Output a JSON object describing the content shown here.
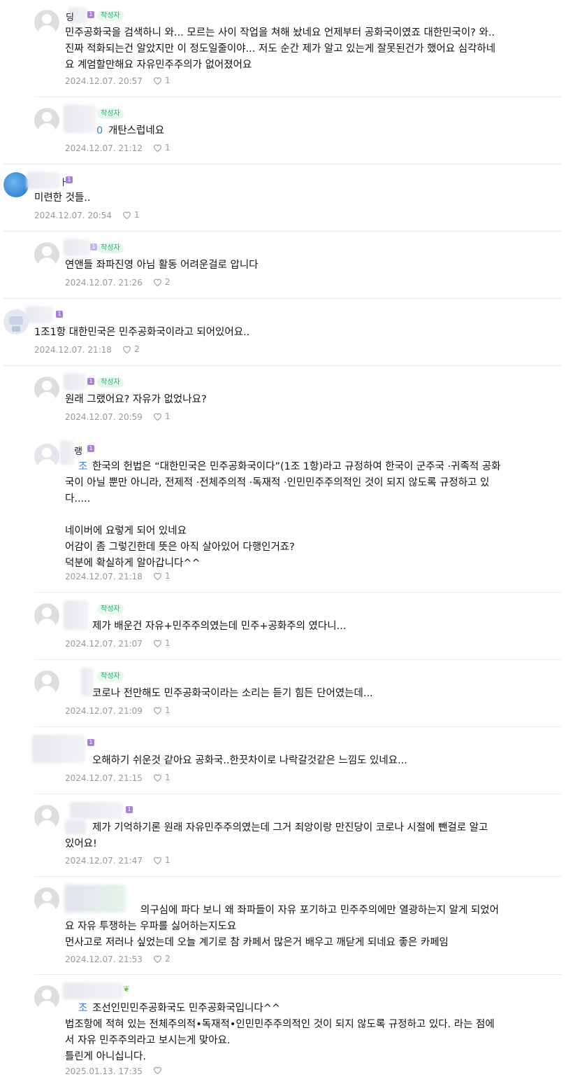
{
  "comments": [
    {
      "nick_visible": "딩",
      "author_badge": "작성자",
      "level": "1",
      "text": "민주공화국을 검색하니 와... 모르는 사이 작업을 쳐해 놨네요 언제부터 공화국이였죠 대한민국이? 와..\n진짜 적화되는건 알았지만 이 정도일줄이야... 저도 순간 제가 알고 있는게 잘못된건가 했어요 심각하네\n요 계엄할만해요 자유민주주의가 없어졌어요",
      "date": "2024.12.07. 20:57",
      "likes": "1"
    },
    {
      "author_badge": "작성자",
      "mention": "0",
      "text": "개탄스럽네요",
      "date": "2024.12.07. 21:12",
      "likes": "1"
    },
    {
      "nick_visible": "ㅏ",
      "level": "1",
      "text": "미련한 것들..",
      "date": "2024.12.07. 20:54",
      "likes": "1"
    },
    {
      "author_badge": "작성자",
      "level": "1",
      "text": "연앤들 좌파진영 아님 활동 어려운걸로 압니다",
      "date": "2024.12.07. 21:26",
      "likes": "2"
    },
    {
      "level": "1",
      "text": "1조1항 대한민국은 민주공화국이라고 되어있어요..",
      "date": "2024.12.07. 21:18",
      "likes": "2"
    },
    {
      "author_badge": "작성자",
      "level": "1",
      "text": "원래 그랬어요? 자유가 없었나요?",
      "date": "2024.12.07. 20:59",
      "likes": "1"
    },
    {
      "nick_visible": "랭",
      "level": "1",
      "mention": "조",
      "text": "한국의 헌법은 “대한민국은 민주공화국이다”(1조 1항)라고 규정하여 한국이 군주국 ·귀족적 공화\n국이 아닐 뿐만 아니라, 전제적 ·전체주의적 ·독재적 ·인민민주주의적인 것이 되지 않도록 규정하고 있\n다.....\n\n네이버에 요렇게 되어 있네요\n어감이 좀 그렇긴한데 뜻은 아직 살아있어 다행인거죠?\n덕분에 확실하게 알아갑니다^^",
      "date": "2024.12.07. 21:18",
      "likes": "1"
    },
    {
      "author_badge": "작성자",
      "text": "제가 배운건 자유+민주주의였는데 민주+공화주의 였다니...",
      "date": "2024.12.07. 21:07",
      "likes": "1"
    },
    {
      "author_badge": "작성자",
      "text": "코로나 전만해도 민주공화국이라는 소리는 듣기 힘든 단어였는데...",
      "date": "2024.12.07. 21:09",
      "likes": "1"
    },
    {
      "level": "1",
      "text": "오해하기 쉬운것 같아요 공화국..한끗차이로 나락갈것같은 느낌도 있네요...",
      "date": "2024.12.07. 21:15",
      "likes": "1"
    },
    {
      "level": "1",
      "text": "제가 기억하기론 원래 자유민주주의였는데 그거 죄앙이랑 만진당이 코로나 시절에 뺀걸로 알고\n있어요!",
      "date": "2024.12.07. 21:47",
      "likes": "1"
    },
    {
      "text": "의구심에 파다 보니 왜 좌파들이 자유 포기하고 민주주의에만 열광하는지 알게 되었어\n요 자유 투쟁하는 우파를 싫어하는지도요\n먼사고로 저러나 싶었는데 오늘 계기로 참 카페서 많은거 배우고 깨닫게 되네요 좋은 카페임",
      "date": "2024.12.07. 21:53",
      "likes": "2"
    },
    {
      "mention": "조",
      "text": "조선인민민주공화국도 민주공화국입니다^^\n법조항에 적혀 있는 전체주의적•독재적•인민민주주의적인 것이 되지 않도록 규정하고 있다. 라는 점에\n서 자유 민주주의라고 보시는게 맞아요.\n틀린게 아니십니다.",
      "date": "2025.01.13. 17:35",
      "likes": ""
    }
  ]
}
